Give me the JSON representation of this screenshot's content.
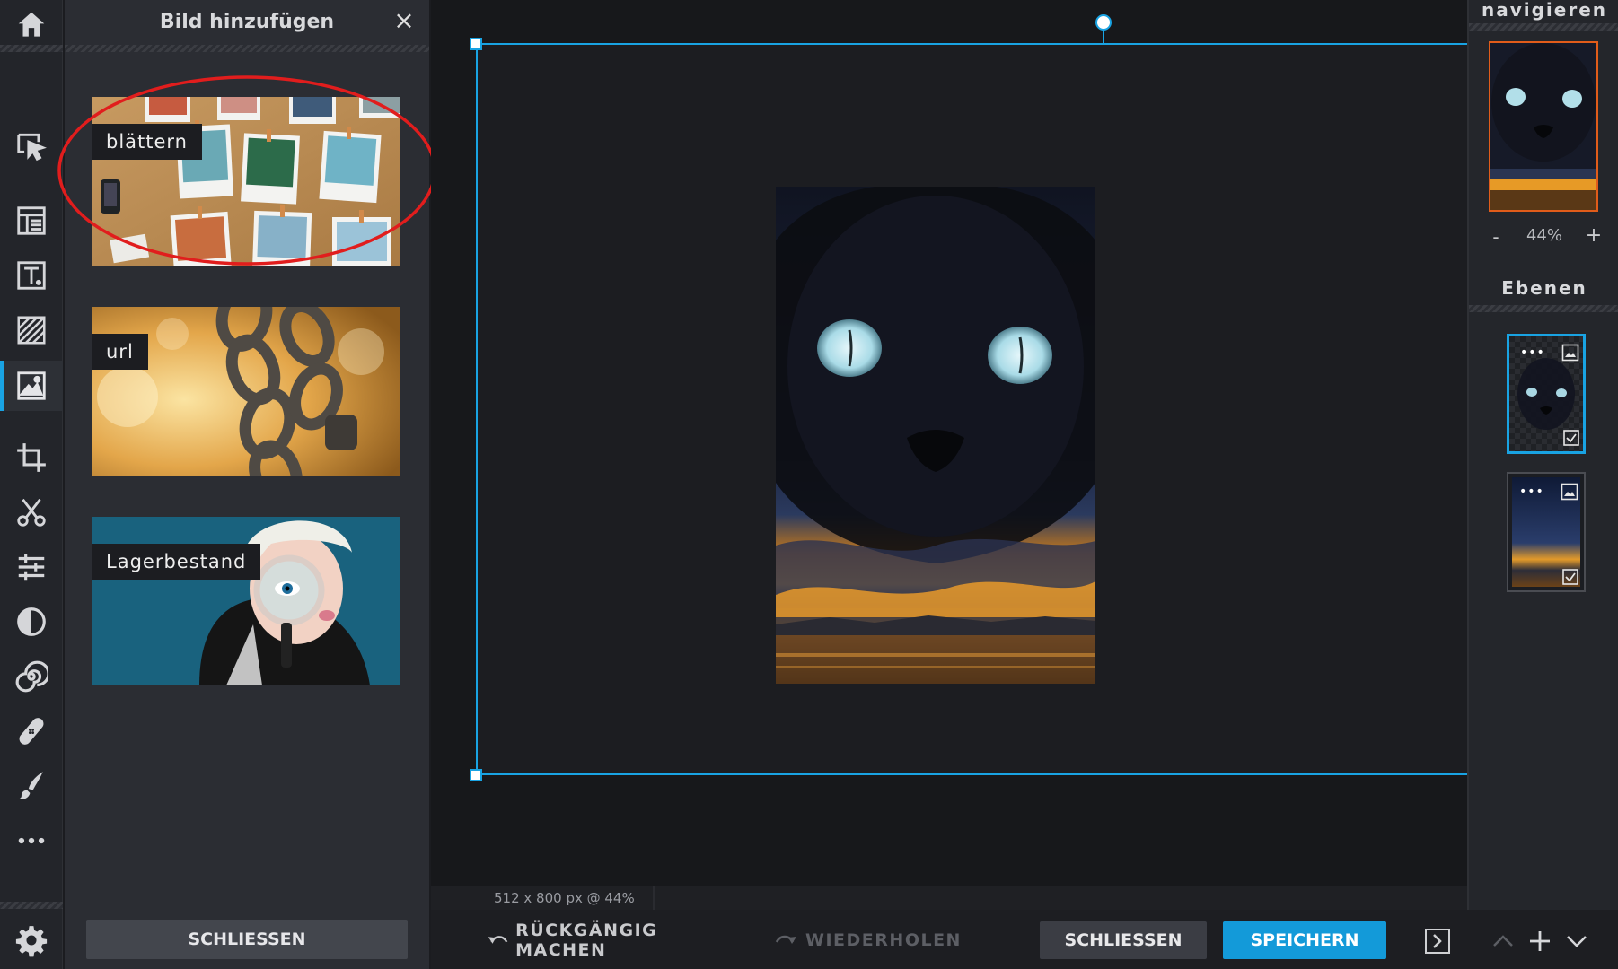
{
  "panel": {
    "title": "Bild hinzufügen",
    "close_symbol": "×",
    "options": [
      {
        "label": "blättern"
      },
      {
        "label": "url"
      },
      {
        "label": "Lagerbestand"
      }
    ],
    "close_button": "SCHLIESSEN"
  },
  "toolbar": {
    "tools": [
      "home-icon",
      "select-arrow-icon",
      "layout-icon",
      "text-icon",
      "texture-icon",
      "image-icon",
      "crop-icon",
      "cut-icon",
      "adjust-icon",
      "contrast-icon",
      "spiral-icon",
      "healing-icon",
      "brush-icon",
      "more-icon",
      "settings-icon"
    ],
    "active_tool": "image-icon"
  },
  "canvas": {
    "status": "512 x 800 px @ 44%",
    "accent": "#19a3e3"
  },
  "bottom_bar": {
    "undo": "RÜCKGÄNGIG MACHEN",
    "redo": "WIEDERHOLEN",
    "close": "SCHLIESSEN",
    "save": "SPEICHERN"
  },
  "navigator": {
    "title": "navigieren",
    "zoom_minus": "-",
    "zoom": "44%",
    "zoom_plus": "+"
  },
  "layers": {
    "title": "Ebenen",
    "menu_dots": "•••"
  },
  "colors": {
    "accent": "#19a3e3",
    "annotation": "#e11d1d"
  }
}
